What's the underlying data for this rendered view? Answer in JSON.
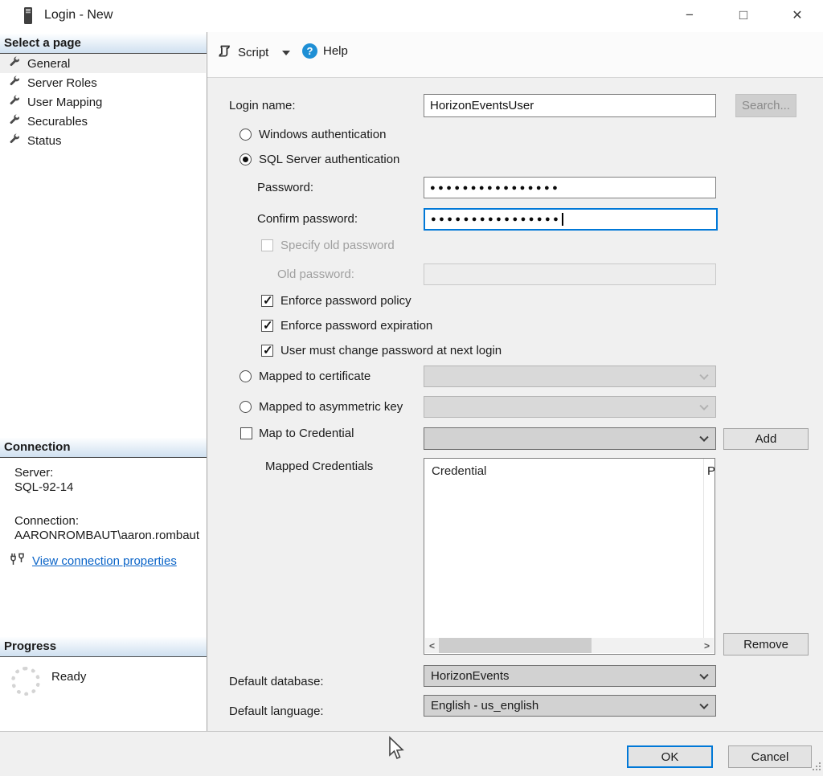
{
  "window": {
    "title": "Login - New",
    "minimize": "−",
    "maximize": "□",
    "close": "✕"
  },
  "toolbar": {
    "script": "Script",
    "help": "Help",
    "help_glyph": "?"
  },
  "sidebar": {
    "pages_header": "Select a page",
    "pages": [
      {
        "label": "General"
      },
      {
        "label": "Server Roles"
      },
      {
        "label": "User Mapping"
      },
      {
        "label": "Securables"
      },
      {
        "label": "Status"
      }
    ],
    "connection_header": "Connection",
    "server_label": "Server:",
    "server_value": "SQL-92-14",
    "connection_label": "Connection:",
    "connection_value": "AARONROMBAUT\\aaron.rombaut",
    "view_link": "View connection properties",
    "progress_header": "Progress",
    "progress_status": "Ready"
  },
  "form": {
    "login_name_label": "Login name:",
    "login_name_value": "HorizonEventsUser",
    "search_button": "Search...",
    "windows_auth": "Windows authentication",
    "sql_auth": "SQL Server authentication",
    "password_label": "Password:",
    "password_mask": "●●●●●●●●●●●●●●●●",
    "confirm_label": "Confirm password:",
    "confirm_mask": "●●●●●●●●●●●●●●●●",
    "specify_old": "Specify old password",
    "old_password_label": "Old password:",
    "policy_checkboxes": [
      "Enforce password policy",
      "Enforce password expiration",
      "User must change password at next login"
    ],
    "mapped_cert": "Mapped to certificate",
    "mapped_key": "Mapped to asymmetric key",
    "map_credential": "Map to Credential",
    "add_button": "Add",
    "mapped_credentials_label": "Mapped Credentials",
    "grid_col_credential": "Credential",
    "grid_col_partial": "P",
    "remove_button": "Remove",
    "default_db_label": "Default database:",
    "default_db_value": "HorizonEvents",
    "default_lang_label": "Default language:",
    "default_lang_value": "English - us_english"
  },
  "footer": {
    "ok": "OK",
    "cancel": "Cancel"
  },
  "colors": {
    "accent": "#0078d7",
    "link": "#0a64c8"
  }
}
